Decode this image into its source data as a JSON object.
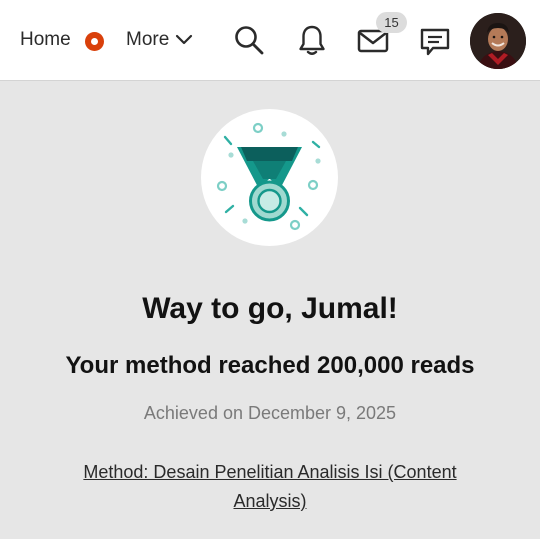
{
  "header": {
    "home_label": "Home",
    "more_label": "More",
    "notifications_badge": "15",
    "icons": {
      "home_indicator": "home-indicator-dot",
      "more": "chevron-down-icon",
      "search": "search-icon",
      "notifications": "bell-icon",
      "messages": "mail-icon",
      "chat": "chat-bubble-icon",
      "profile": "user-avatar"
    },
    "accent_color": "#d9400b"
  },
  "achievement": {
    "icon": "medal-icon",
    "title": "Way to go, Jumal!",
    "subtitle": "Your method reached 200,000 reads",
    "date_text": "Achieved on December 9, 2025",
    "link_text": "Method: Desain Penelitian Analisis Isi (Content Analysis)",
    "medal_colors": {
      "ribbon": "#14988b",
      "ribbon_dark": "#0c5f5c",
      "medal": "#9fd9d0",
      "confetti": "#7dcfc6"
    }
  }
}
